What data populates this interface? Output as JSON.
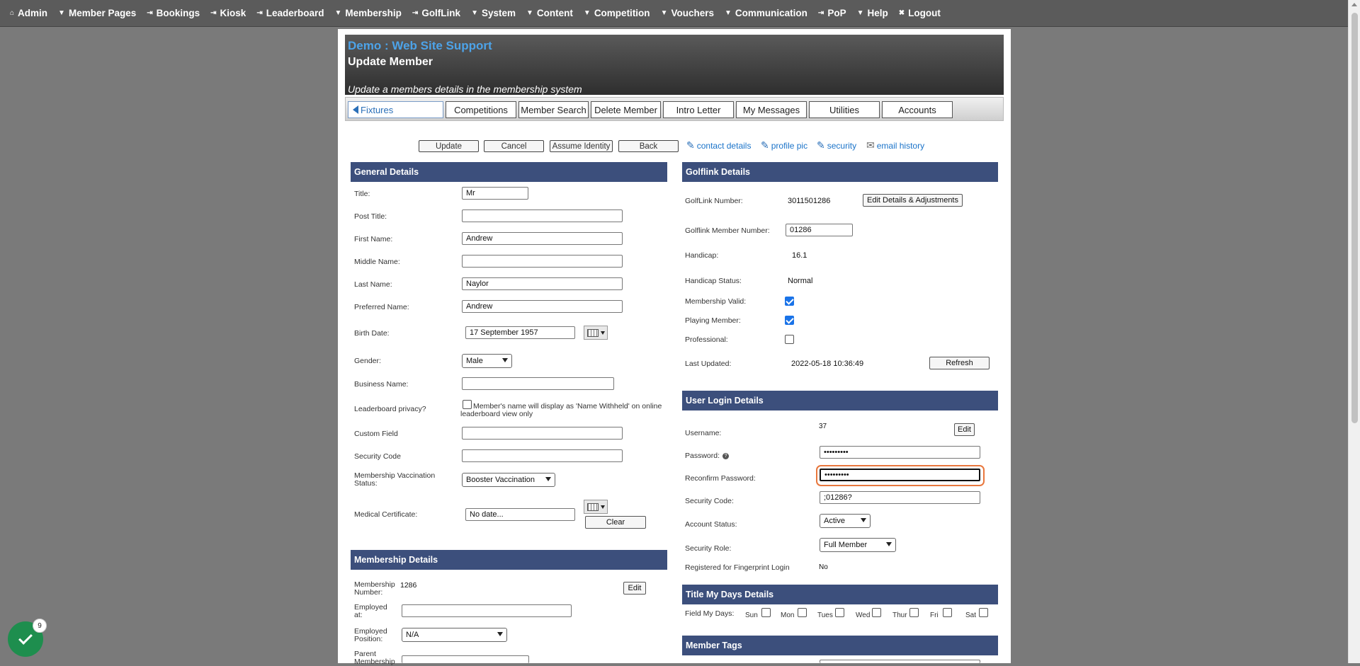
{
  "nav": [
    {
      "icon": "home-icon",
      "glyph": "⌂",
      "label": "Admin"
    },
    {
      "icon": "dropdown-icon",
      "glyph": "▼",
      "label": "Member Pages"
    },
    {
      "icon": "link-icon",
      "glyph": "⇥",
      "label": "Bookings"
    },
    {
      "icon": "link-icon",
      "glyph": "⇥",
      "label": "Kiosk"
    },
    {
      "icon": "link-icon",
      "glyph": "⇥",
      "label": "Leaderboard"
    },
    {
      "icon": "dropdown-icon",
      "glyph": "▼",
      "label": "Membership"
    },
    {
      "icon": "link-icon",
      "glyph": "⇥",
      "label": "GolfLink"
    },
    {
      "icon": "dropdown-icon",
      "glyph": "▼",
      "label": "System"
    },
    {
      "icon": "dropdown-icon",
      "glyph": "▼",
      "label": "Content"
    },
    {
      "icon": "dropdown-icon",
      "glyph": "▼",
      "label": "Competition"
    },
    {
      "icon": "dropdown-icon",
      "glyph": "▼",
      "label": "Vouchers"
    },
    {
      "icon": "dropdown-icon",
      "glyph": "▼",
      "label": "Communication"
    },
    {
      "icon": "link-icon",
      "glyph": "⇥",
      "label": "PoP"
    },
    {
      "icon": "dropdown-icon",
      "glyph": "▼",
      "label": "Help"
    },
    {
      "icon": "close-icon",
      "glyph": "✖",
      "label": "Logout"
    }
  ],
  "header": {
    "site": "Demo : Web Site Support",
    "title": "Update Member",
    "desc": "Update a members details in the membership system"
  },
  "tabs": [
    "Fixtures",
    "Competitions",
    "Member Search",
    "Delete Member",
    "Intro Letter",
    "My Messages",
    "Utilities",
    "Accounts"
  ],
  "actions": {
    "update": "Update",
    "cancel": "Cancel",
    "assume": "Assume Identity",
    "back": "Back",
    "contact": "contact details",
    "profile": "profile pic",
    "security": "security",
    "email": "email history"
  },
  "general": {
    "heading": "General Details",
    "title_lbl": "Title:",
    "title_val": "Mr",
    "post_lbl": "Post Title:",
    "post_val": "",
    "first_lbl": "First Name:",
    "first_val": "Andrew",
    "middle_lbl": "Middle Name:",
    "middle_val": "",
    "last_lbl": "Last Name:",
    "last_val": "Naylor",
    "pref_lbl": "Preferred Name:",
    "pref_val": "Andrew",
    "birth_lbl": "Birth Date:",
    "birth_val": "17 September 1957",
    "gender_lbl": "Gender:",
    "gender_val": "Male",
    "biz_lbl": "Business Name:",
    "biz_val": "",
    "lb_lbl": "Leaderboard privacy?",
    "lb_text": "Member's name will display as 'Name Withheld' on online leaderboard view only",
    "custom_lbl": "Custom Field",
    "custom_val": "",
    "sec_lbl": "Security Code",
    "sec_val": "",
    "vacc_lbl": "Membership Vaccination Status:",
    "vacc_val": "Booster Vaccination",
    "med_lbl": "Medical Certificate:",
    "med_val": "No date...",
    "clear": "Clear"
  },
  "membership": {
    "heading": "Membership Details",
    "num_lbl": "Membership Number:",
    "num_val": "1286",
    "edit": "Edit",
    "emp_lbl": "Employed at:",
    "emp_val": "",
    "pos_lbl": "Employed Position:",
    "pos_val": "N/A",
    "parent_lbl": "Parent Membership"
  },
  "golflink": {
    "heading": "Golflink Details",
    "gl_lbl": "GolfLink Number:",
    "gl_val": "3011501286",
    "gl_btn": "Edit Details & Adjustments",
    "mem_lbl": "Golflink Member Number:",
    "mem_val": "01286",
    "hcp_lbl": "Handicap:",
    "hcp_val": "16.1",
    "hs_lbl": "Handicap Status:",
    "hs_val": "Normal",
    "mv_lbl": "Membership Valid:",
    "pm_lbl": "Playing Member:",
    "pro_lbl": "Professional:",
    "lu_lbl": "Last Updated:",
    "lu_val": "2022-05-18 10:36:49",
    "refresh": "Refresh"
  },
  "login": {
    "heading": "User Login Details",
    "user_lbl": "Username:",
    "user_val": "37",
    "edit": "Edit",
    "pw_lbl": "Password:",
    "pw_val": "•••••••••",
    "rpw_lbl": "Reconfirm Password:",
    "rpw_val": "•••••••••",
    "sc_lbl": "Security Code:",
    "sc_val": ";01286?",
    "as_lbl": "Account Status:",
    "as_val": "Active",
    "sr_lbl": "Security Role:",
    "sr_val": "Full Member",
    "fp_lbl": "Registered for Fingerprint Login",
    "fp_val": "No"
  },
  "mydays": {
    "heading": "Title My Days Details",
    "lbl": "Field My Days:",
    "days": [
      "Sun",
      "Mon",
      "Tues",
      "Wed",
      "Thur",
      "Fri",
      "Sat"
    ]
  },
  "tags": {
    "heading": "Member Tags"
  },
  "badge": {
    "count": "9"
  },
  "colors": {
    "section": "#3c4f7c",
    "focus": "#e8773d",
    "link": "#1a73c9"
  }
}
